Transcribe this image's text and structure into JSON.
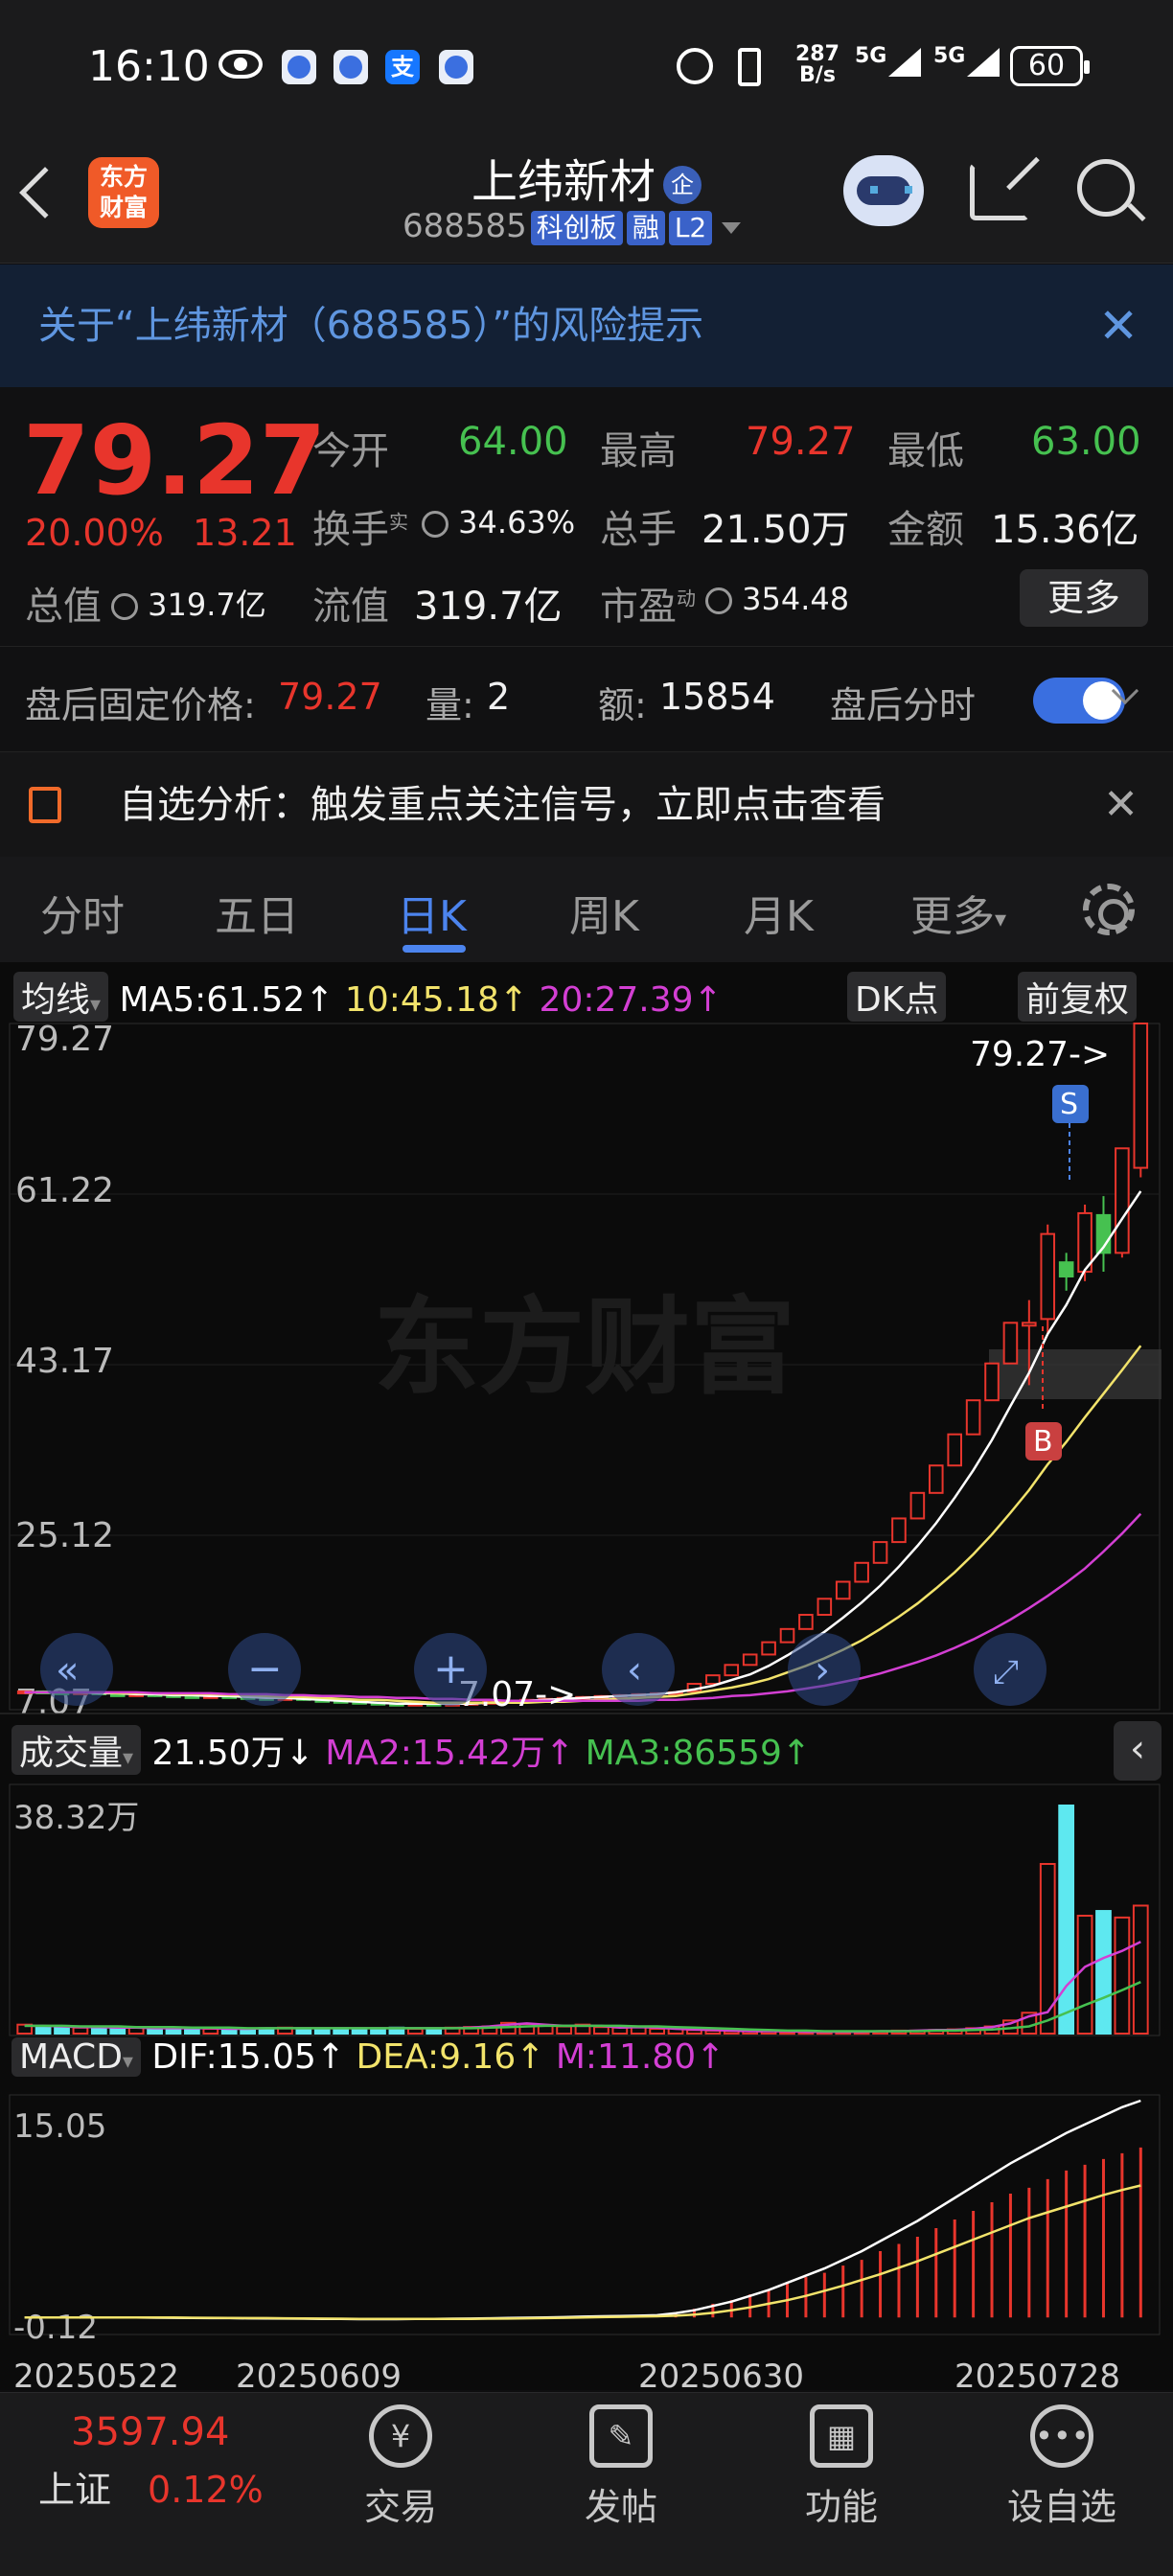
{
  "status_bar": {
    "time": "16:10",
    "net_speed_top": "287",
    "net_speed_bottom": "B/s",
    "signal1": "5G",
    "signal2": "5G",
    "battery": "60"
  },
  "nav": {
    "logo_line1": "东方",
    "logo_line2": "财富",
    "title": "上纬新材",
    "title_badge": "企",
    "code": "688585",
    "tags": [
      "科创板",
      "融",
      "L2"
    ]
  },
  "alert": {
    "text": "关于“上纬新材（688585）”的风险提示",
    "close": "✕"
  },
  "quote": {
    "price": "79.27",
    "pct": "20.00%",
    "change": "13.21",
    "open_label": "今开",
    "open": "64.00",
    "high_label": "最高",
    "high": "79.27",
    "low_label": "最低",
    "low": "63.00",
    "turnover_label": "换手",
    "turnover_sup": "实",
    "turnover": "34.63%",
    "volume_label": "总手",
    "volume": "21.50万",
    "amount_label": "金额",
    "amount": "15.36亿",
    "mktcap_label": "总值",
    "mktcap": "319.7亿",
    "float_label": "流值",
    "float": "319.7亿",
    "pe_label": "市盈",
    "pe_sup": "动",
    "pe": "354.48",
    "more": "更多"
  },
  "after_hours": {
    "label": "盘后固定价格:",
    "price": "79.27",
    "vol_label": "量:",
    "vol": "2",
    "amt_label": "额:",
    "amt": "15854",
    "time_label": "盘后分时"
  },
  "analysis": {
    "text": "自选分析：触发重点关注信号，立即点击查看",
    "close": "✕"
  },
  "tabs": [
    "分时",
    "五日",
    "日K",
    "周K",
    "月K",
    "更多"
  ],
  "active_tab": "日K",
  "kline": {
    "ma_label": "均线",
    "ma5": "MA5:61.52↑",
    "ma10": "10:45.18↑",
    "ma20": "20:27.39↑",
    "dk": "DK点",
    "adjust": "前复权",
    "axis": [
      "79.27",
      "61.22",
      "43.17",
      "25.12",
      "7.07"
    ],
    "max_note": "79.27->",
    "min_note": "7.07->",
    "watermark": "东方财富",
    "sell": "S",
    "buy": "B"
  },
  "volume": {
    "label": "成交量",
    "value": "21.50万↓",
    "ma2": "MA2:15.42万↑",
    "ma3": "MA3:86559↑",
    "axis_top": "38.32万"
  },
  "macd": {
    "label": "MACD",
    "dif": "DIF:15.05↑",
    "dea": "DEA:9.16↑",
    "m": "M:11.80↑",
    "axis_top": "15.05",
    "axis_bottom": "-0.12"
  },
  "dates": [
    "20250522",
    "20250609",
    "20250630",
    "20250728"
  ],
  "bottom_bar": {
    "index_value": "3597.94",
    "index_name": "上证",
    "index_pct": "0.12%",
    "items": [
      "交易",
      "发帖",
      "功能",
      "设自选"
    ]
  },
  "colors": {
    "up": "#e8352c",
    "down": "#46c150",
    "accent": "#4c84ee",
    "ma5": "#ffffff",
    "ma10": "#f2e36b",
    "ma20": "#d33fd3",
    "vol_down": "#5ee8f0"
  },
  "chart_data": {
    "type": "candlestick",
    "ylim": [
      7.07,
      79.27
    ],
    "candles": [
      {
        "o": 8.5,
        "c": 8.6,
        "h": 8.7,
        "l": 8.3
      },
      {
        "o": 8.6,
        "c": 8.5,
        "h": 8.7,
        "l": 8.4
      },
      {
        "o": 8.5,
        "c": 8.4,
        "h": 8.6,
        "l": 8.3
      },
      {
        "o": 8.4,
        "c": 8.5,
        "h": 8.6,
        "l": 8.3
      },
      {
        "o": 8.5,
        "c": 8.3,
        "h": 8.6,
        "l": 8.2
      },
      {
        "o": 8.3,
        "c": 8.2,
        "h": 8.4,
        "l": 8.1
      },
      {
        "o": 8.2,
        "c": 8.3,
        "h": 8.4,
        "l": 8.1
      },
      {
        "o": 8.3,
        "c": 8.2,
        "h": 8.3,
        "l": 8.0
      },
      {
        "o": 8.2,
        "c": 8.1,
        "h": 8.3,
        "l": 8.0
      },
      {
        "o": 8.1,
        "c": 8.0,
        "h": 8.2,
        "l": 7.9
      },
      {
        "o": 8.0,
        "c": 8.1,
        "h": 8.2,
        "l": 7.9
      },
      {
        "o": 8.1,
        "c": 8.0,
        "h": 8.2,
        "l": 7.9
      },
      {
        "o": 8.0,
        "c": 7.9,
        "h": 8.1,
        "l": 7.8
      },
      {
        "o": 7.9,
        "c": 7.8,
        "h": 8.0,
        "l": 7.7
      },
      {
        "o": 7.8,
        "c": 7.9,
        "h": 8.0,
        "l": 7.7
      },
      {
        "o": 7.9,
        "c": 7.7,
        "h": 8.0,
        "l": 7.6
      },
      {
        "o": 7.7,
        "c": 7.6,
        "h": 7.8,
        "l": 7.5
      },
      {
        "o": 7.6,
        "c": 7.5,
        "h": 7.7,
        "l": 7.4
      },
      {
        "o": 7.5,
        "c": 7.4,
        "h": 7.6,
        "l": 7.3
      },
      {
        "o": 7.4,
        "c": 7.3,
        "h": 7.5,
        "l": 7.2
      },
      {
        "o": 7.3,
        "c": 7.2,
        "h": 7.4,
        "l": 7.1
      },
      {
        "o": 7.2,
        "c": 7.3,
        "h": 7.4,
        "l": 7.1
      },
      {
        "o": 7.3,
        "c": 7.2,
        "h": 7.4,
        "l": 7.07
      },
      {
        "o": 7.2,
        "c": 7.3,
        "h": 7.4,
        "l": 7.1
      },
      {
        "o": 7.3,
        "c": 7.4,
        "h": 7.5,
        "l": 7.2
      },
      {
        "o": 7.4,
        "c": 7.5,
        "h": 7.6,
        "l": 7.3
      },
      {
        "o": 7.5,
        "c": 7.6,
        "h": 7.7,
        "l": 7.4
      },
      {
        "o": 7.6,
        "c": 7.7,
        "h": 7.8,
        "l": 7.5
      },
      {
        "o": 7.7,
        "c": 7.8,
        "h": 7.9,
        "l": 7.6
      },
      {
        "o": 7.8,
        "c": 7.9,
        "h": 8.0,
        "l": 7.7
      },
      {
        "o": 7.9,
        "c": 8.0,
        "h": 8.1,
        "l": 7.8
      },
      {
        "o": 8.0,
        "c": 8.1,
        "h": 8.2,
        "l": 7.9
      },
      {
        "o": 8.1,
        "c": 8.2,
        "h": 8.3,
        "l": 8.0
      },
      {
        "o": 8.2,
        "c": 8.3,
        "h": 8.4,
        "l": 8.1
      },
      {
        "o": 8.3,
        "c": 8.4,
        "h": 8.5,
        "l": 8.2
      },
      {
        "o": 8.4,
        "c": 8.5,
        "h": 8.6,
        "l": 8.3
      },
      {
        "o": 8.6,
        "c": 9.4,
        "h": 9.4,
        "l": 8.6
      },
      {
        "o": 9.4,
        "c": 10.3,
        "h": 10.3,
        "l": 9.4
      },
      {
        "o": 10.3,
        "c": 11.4,
        "h": 11.4,
        "l": 10.3
      },
      {
        "o": 11.4,
        "c": 12.5,
        "h": 12.5,
        "l": 11.4
      },
      {
        "o": 12.5,
        "c": 13.8,
        "h": 13.8,
        "l": 12.5
      },
      {
        "o": 13.8,
        "c": 15.2,
        "h": 15.2,
        "l": 13.8
      },
      {
        "o": 15.2,
        "c": 16.7,
        "h": 16.7,
        "l": 15.2
      },
      {
        "o": 16.7,
        "c": 18.4,
        "h": 18.4,
        "l": 16.7
      },
      {
        "o": 18.4,
        "c": 20.2,
        "h": 20.2,
        "l": 18.4
      },
      {
        "o": 20.2,
        "c": 22.2,
        "h": 22.2,
        "l": 20.2
      },
      {
        "o": 22.2,
        "c": 24.4,
        "h": 24.4,
        "l": 22.2
      },
      {
        "o": 24.4,
        "c": 26.9,
        "h": 26.9,
        "l": 24.4
      },
      {
        "o": 26.9,
        "c": 29.6,
        "h": 29.6,
        "l": 26.9
      },
      {
        "o": 29.6,
        "c": 32.5,
        "h": 32.5,
        "l": 29.6
      },
      {
        "o": 32.5,
        "c": 35.8,
        "h": 35.8,
        "l": 32.5
      },
      {
        "o": 35.8,
        "c": 39.4,
        "h": 39.4,
        "l": 35.8
      },
      {
        "o": 39.4,
        "c": 43.3,
        "h": 43.3,
        "l": 39.4
      },
      {
        "o": 43.3,
        "c": 47.6,
        "h": 47.6,
        "l": 43.3
      },
      {
        "o": 47.3,
        "c": 47.6,
        "h": 50.0,
        "l": 41.0
      },
      {
        "o": 48.0,
        "c": 57.0,
        "h": 58.0,
        "l": 46.5
      },
      {
        "o": 54.0,
        "c": 52.5,
        "h": 55.0,
        "l": 51.0
      },
      {
        "o": 53.0,
        "c": 59.2,
        "h": 60.1,
        "l": 52.0
      },
      {
        "o": 59.0,
        "c": 55.0,
        "h": 61.0,
        "l": 53.0
      },
      {
        "o": 55.0,
        "c": 66.06,
        "h": 66.06,
        "l": 54.5
      },
      {
        "o": 64.0,
        "c": 79.27,
        "h": 79.27,
        "l": 63.0
      }
    ],
    "ma5": [
      8.5,
      8.5,
      8.5,
      8.5,
      8.4,
      8.4,
      8.3,
      8.3,
      8.2,
      8.2,
      8.1,
      8.1,
      8.0,
      7.9,
      7.9,
      7.8,
      7.7,
      7.6,
      7.5,
      7.4,
      7.3,
      7.3,
      7.3,
      7.3,
      7.3,
      7.4,
      7.5,
      7.6,
      7.7,
      7.8,
      7.9,
      8.0,
      8.1,
      8.2,
      8.3,
      8.5,
      8.8,
      9.2,
      9.8,
      10.4,
      11.3,
      12.4,
      13.6,
      14.9,
      16.4,
      18.0,
      19.8,
      21.8,
      24.0,
      26.4,
      29.1,
      32.0,
      35.2,
      38.8,
      42.3,
      46.4,
      49.5,
      53.2,
      55.6,
      58.6,
      61.52
    ],
    "ma10": [
      8.5,
      8.5,
      8.5,
      8.5,
      8.5,
      8.4,
      8.4,
      8.4,
      8.3,
      8.3,
      8.3,
      8.2,
      8.2,
      8.1,
      8.0,
      8.0,
      7.9,
      7.8,
      7.7,
      7.7,
      7.6,
      7.5,
      7.4,
      7.4,
      7.4,
      7.4,
      7.4,
      7.4,
      7.5,
      7.5,
      7.6,
      7.7,
      7.8,
      7.9,
      8.0,
      8.1,
      8.4,
      8.7,
      9.0,
      9.4,
      9.9,
      10.6,
      11.3,
      12.1,
      13.0,
      14.0,
      15.2,
      16.5,
      17.9,
      19.5,
      21.2,
      23.1,
      25.2,
      27.5,
      29.9,
      32.6,
      35.0,
      37.6,
      40.1,
      42.6,
      45.18
    ],
    "ma20": [
      8.5,
      8.5,
      8.5,
      8.5,
      8.5,
      8.5,
      8.5,
      8.4,
      8.4,
      8.4,
      8.4,
      8.3,
      8.3,
      8.3,
      8.2,
      8.2,
      8.1,
      8.1,
      8.0,
      8.0,
      7.9,
      7.9,
      7.8,
      7.8,
      7.7,
      7.7,
      7.6,
      7.6,
      7.6,
      7.6,
      7.6,
      7.6,
      7.6,
      7.6,
      7.7,
      7.7,
      7.8,
      7.9,
      8.1,
      8.2,
      8.4,
      8.6,
      8.9,
      9.2,
      9.6,
      10.0,
      10.5,
      11.1,
      11.7,
      12.4,
      13.2,
      14.1,
      15.1,
      16.2,
      17.4,
      18.7,
      20.1,
      21.6,
      23.4,
      25.3,
      27.39
    ],
    "volume": [
      1.5,
      1.2,
      1.3,
      1.0,
      1.1,
      0.9,
      1.0,
      0.8,
      1.0,
      0.9,
      0.8,
      0.9,
      0.8,
      0.9,
      1.0,
      0.9,
      0.8,
      0.9,
      0.8,
      0.9,
      1.0,
      0.8,
      0.9,
      1.0,
      1.1,
      1.2,
      1.8,
      1.6,
      1.4,
      1.2,
      1.5,
      1.1,
      1.0,
      1.2,
      0.8,
      0.9,
      0.6,
      0.5,
      0.4,
      0.4,
      0.4,
      0.3,
      0.3,
      0.3,
      0.3,
      0.3,
      0.4,
      0.5,
      0.5,
      0.6,
      0.7,
      0.9,
      1.2,
      2.2,
      3.5,
      28.5,
      38.32,
      19.8,
      20.6,
      19.5,
      21.5
    ],
    "vol_ma2": [
      1.3,
      1.3,
      1.2,
      1.1,
      1.1,
      1.0,
      1.0,
      0.9,
      0.9,
      0.9,
      0.9,
      0.8,
      0.8,
      0.9,
      0.9,
      0.9,
      0.9,
      0.9,
      0.9,
      0.9,
      0.9,
      0.9,
      0.9,
      0.9,
      1.0,
      1.2,
      1.5,
      1.7,
      1.5,
      1.3,
      1.3,
      1.3,
      1.0,
      1.1,
      1.0,
      0.8,
      0.7,
      0.6,
      0.5,
      0.4,
      0.4,
      0.4,
      0.3,
      0.3,
      0.3,
      0.3,
      0.4,
      0.4,
      0.5,
      0.6,
      0.6,
      0.8,
      1.1,
      1.7,
      2.9,
      3.6,
      8.0,
      11.2,
      12.7,
      13.9,
      15.42
    ],
    "vol_ma3": [
      1.3,
      1.3,
      1.3,
      1.2,
      1.2,
      1.2,
      1.1,
      1.1,
      1.1,
      1.0,
      1.0,
      1.0,
      0.9,
      0.9,
      0.9,
      0.9,
      0.9,
      0.9,
      0.9,
      0.9,
      0.9,
      0.9,
      0.9,
      0.9,
      0.9,
      1.0,
      1.1,
      1.2,
      1.3,
      1.3,
      1.3,
      1.3,
      1.3,
      1.2,
      1.2,
      1.1,
      1.0,
      0.9,
      0.8,
      0.7,
      0.6,
      0.5,
      0.5,
      0.4,
      0.4,
      0.4,
      0.4,
      0.4,
      0.4,
      0.5,
      0.5,
      0.6,
      0.7,
      0.9,
      1.2,
      2.2,
      3.5,
      4.8,
      6.0,
      7.3,
      8.66
    ],
    "dif": [
      0,
      0,
      0,
      0,
      0,
      0,
      0,
      -0.02,
      -0.03,
      -0.04,
      -0.05,
      -0.05,
      -0.06,
      -0.07,
      -0.08,
      -0.09,
      -0.1,
      -0.11,
      -0.12,
      -0.12,
      -0.12,
      -0.11,
      -0.1,
      -0.09,
      -0.08,
      -0.06,
      -0.04,
      -0.02,
      0,
      0.02,
      0.05,
      0.08,
      0.1,
      0.12,
      0.15,
      0.3,
      0.5,
      0.8,
      1.1,
      1.5,
      1.9,
      2.4,
      2.9,
      3.4,
      4.0,
      4.6,
      5.3,
      6.0,
      6.7,
      7.5,
      8.3,
      9.1,
      9.9,
      10.7,
      11.4,
      12.1,
      12.8,
      13.4,
      14.0,
      14.6,
      15.05
    ],
    "dea": [
      0,
      0,
      0,
      0,
      0,
      0,
      0,
      0,
      -0.01,
      -0.02,
      -0.03,
      -0.04,
      -0.05,
      -0.05,
      -0.06,
      -0.07,
      -0.08,
      -0.09,
      -0.1,
      -0.11,
      -0.11,
      -0.11,
      -0.11,
      -0.1,
      -0.1,
      -0.09,
      -0.08,
      -0.06,
      -0.05,
      -0.03,
      -0.01,
      0.02,
      0.04,
      0.06,
      0.08,
      0.12,
      0.2,
      0.32,
      0.5,
      0.7,
      0.95,
      1.2,
      1.5,
      1.85,
      2.2,
      2.6,
      3.0,
      3.45,
      3.9,
      4.4,
      4.9,
      5.4,
      5.9,
      6.4,
      6.9,
      7.3,
      7.7,
      8.1,
      8.5,
      8.85,
      9.16
    ],
    "macd_hist": [
      0,
      0,
      0,
      0,
      0,
      0,
      0,
      0,
      0,
      0,
      0,
      0,
      0,
      0,
      0,
      0,
      0,
      0,
      0,
      0,
      0,
      0,
      0,
      0,
      0,
      0,
      0,
      0,
      0,
      0,
      0,
      0,
      0,
      0,
      0,
      0.35,
      0.6,
      0.95,
      1.2,
      1.6,
      1.9,
      2.4,
      2.8,
      3.1,
      3.6,
      4.0,
      4.6,
      5.1,
      5.6,
      6.2,
      6.8,
      7.4,
      8.0,
      8.6,
      9.0,
      9.6,
      10.2,
      10.6,
      11.0,
      11.4,
      11.8
    ],
    "vol_ylim": [
      0,
      38.32
    ],
    "macd_ylim": [
      -0.12,
      15.05
    ]
  }
}
